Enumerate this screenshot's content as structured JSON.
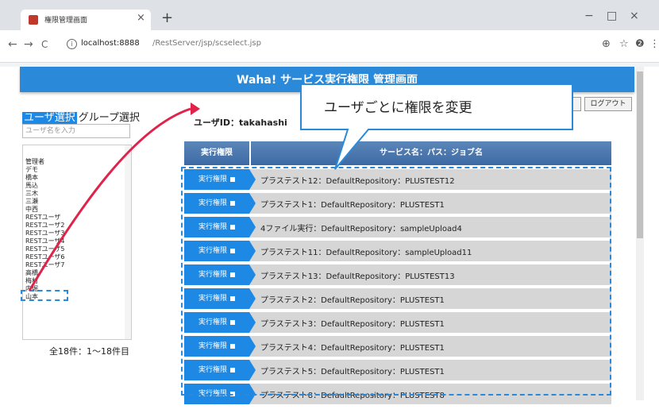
{
  "browser": {
    "tab_title": "権限管理画面",
    "tab_close": "×",
    "new_tab": "+",
    "minimize": "−",
    "maximize": "□",
    "close": "×",
    "back": "←",
    "forward": "→",
    "reload": "C",
    "url_host": "localhost:8888",
    "url_path": "/RestServer/jsp/scselect.jsp",
    "zoom": "⊕",
    "bookmark": "☆",
    "profile": "❷",
    "menu": "⋮"
  },
  "header": {
    "title": "Waha! サービス実行権限 管理画面"
  },
  "left_panel": {
    "tab_user": "ユーザ選択",
    "tab_group": "グループ選択",
    "search_placeholder": "ユーザ名を入力",
    "users": [
      "管理者",
      "デモ",
      "橋本",
      "馬込",
      "三木",
      "三瀬",
      "中西",
      "RESTユーザ",
      "RESTユーザ2",
      "RESTユーザ3",
      "RESTユーザ4",
      "RESTユーザ5",
      "RESTユーザ6",
      "RESTユーザ7",
      "高橋",
      "梅村",
      "内堀",
      "山本"
    ],
    "count_text": "全18件：1～18件目"
  },
  "main": {
    "user_id_label": "ユーザID：takahashi",
    "top_btn_partial": "面",
    "logout_button": "ログアウト",
    "col_perm": "実行権限",
    "col_service": "サービス名：パス：ジョブ名",
    "perm_label": "実行権限",
    "rows": [
      "プラステスト12：DefaultRepository：PLUSTEST12",
      "プラステスト1：DefaultRepository：PLUSTEST1",
      "4ファイル実行：DefaultRepository：sampleUpload4",
      "プラステスト11：DefaultRepository：sampleUpload11",
      "プラステスト13：DefaultRepository：PLUSTEST13",
      "プラステスト2：DefaultRepository：PLUSTEST1",
      "プラステスト3：DefaultRepository：PLUSTEST1",
      "プラステスト4：DefaultRepository：PLUSTEST1",
      "プラステスト5：DefaultRepository：PLUSTEST1",
      "プラステスト8：DefaultRepository：PLUSTEST8"
    ]
  },
  "callout": {
    "text": "ユーザごとに権限を変更"
  },
  "colors": {
    "accent": "#2a89d8",
    "button": "#1e88e5",
    "header_grad": "#3d6aa4",
    "annotation": "#e0234a"
  }
}
